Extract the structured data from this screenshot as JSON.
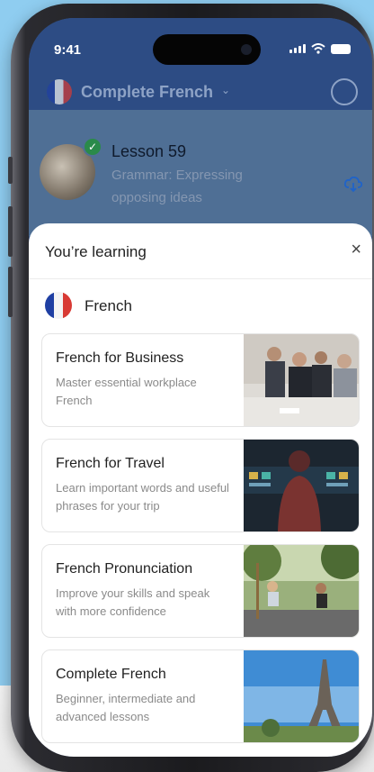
{
  "status_bar": {
    "time": "9:41"
  },
  "header": {
    "course_title": "Complete French"
  },
  "lesson": {
    "title": "Lesson 59",
    "subtitle": "Grammar: Expressing opposing ideas"
  },
  "sheet": {
    "title": "You’re learning",
    "close_label": "×",
    "language": "French",
    "courses": [
      {
        "title": "French for Business",
        "description": "Master essential workplace French",
        "image": "business-meeting"
      },
      {
        "title": "French for Travel",
        "description": "Learn important words and useful phrases for your trip",
        "image": "travel-departures-board"
      },
      {
        "title": "French Pronunciation",
        "description": "Improve your skills and speak with more confidence",
        "image": "park-swings"
      },
      {
        "title": "Complete French",
        "description": "Beginner, intermediate and advanced lessons",
        "image": "eiffel-tower"
      }
    ]
  },
  "colors": {
    "background": "#8fcdf0",
    "header": "#2d4c84",
    "accent_blue": "#1f63c9",
    "check_green": "#2a8a4a"
  }
}
